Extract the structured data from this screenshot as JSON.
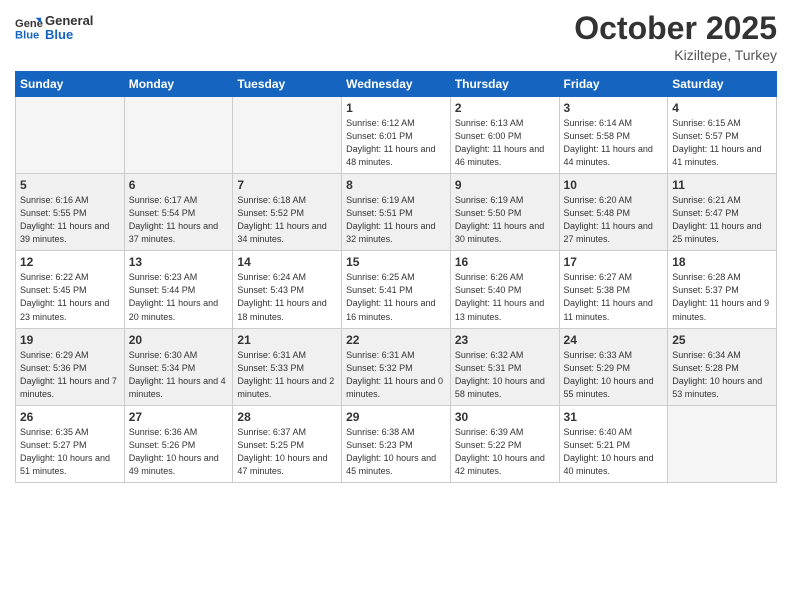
{
  "logo": {
    "line1": "General",
    "line2": "Blue"
  },
  "title": "October 2025",
  "subtitle": "Kiziltepe, Turkey",
  "weekdays": [
    "Sunday",
    "Monday",
    "Tuesday",
    "Wednesday",
    "Thursday",
    "Friday",
    "Saturday"
  ],
  "weeks": [
    [
      {
        "day": "",
        "empty": true
      },
      {
        "day": "",
        "empty": true
      },
      {
        "day": "",
        "empty": true
      },
      {
        "day": "1",
        "sunrise": "6:12 AM",
        "sunset": "6:01 PM",
        "daylight": "11 hours and 48 minutes."
      },
      {
        "day": "2",
        "sunrise": "6:13 AM",
        "sunset": "6:00 PM",
        "daylight": "11 hours and 46 minutes."
      },
      {
        "day": "3",
        "sunrise": "6:14 AM",
        "sunset": "5:58 PM",
        "daylight": "11 hours and 44 minutes."
      },
      {
        "day": "4",
        "sunrise": "6:15 AM",
        "sunset": "5:57 PM",
        "daylight": "11 hours and 41 minutes."
      }
    ],
    [
      {
        "day": "5",
        "sunrise": "6:16 AM",
        "sunset": "5:55 PM",
        "daylight": "11 hours and 39 minutes."
      },
      {
        "day": "6",
        "sunrise": "6:17 AM",
        "sunset": "5:54 PM",
        "daylight": "11 hours and 37 minutes."
      },
      {
        "day": "7",
        "sunrise": "6:18 AM",
        "sunset": "5:52 PM",
        "daylight": "11 hours and 34 minutes."
      },
      {
        "day": "8",
        "sunrise": "6:19 AM",
        "sunset": "5:51 PM",
        "daylight": "11 hours and 32 minutes."
      },
      {
        "day": "9",
        "sunrise": "6:19 AM",
        "sunset": "5:50 PM",
        "daylight": "11 hours and 30 minutes."
      },
      {
        "day": "10",
        "sunrise": "6:20 AM",
        "sunset": "5:48 PM",
        "daylight": "11 hours and 27 minutes."
      },
      {
        "day": "11",
        "sunrise": "6:21 AM",
        "sunset": "5:47 PM",
        "daylight": "11 hours and 25 minutes."
      }
    ],
    [
      {
        "day": "12",
        "sunrise": "6:22 AM",
        "sunset": "5:45 PM",
        "daylight": "11 hours and 23 minutes."
      },
      {
        "day": "13",
        "sunrise": "6:23 AM",
        "sunset": "5:44 PM",
        "daylight": "11 hours and 20 minutes."
      },
      {
        "day": "14",
        "sunrise": "6:24 AM",
        "sunset": "5:43 PM",
        "daylight": "11 hours and 18 minutes."
      },
      {
        "day": "15",
        "sunrise": "6:25 AM",
        "sunset": "5:41 PM",
        "daylight": "11 hours and 16 minutes."
      },
      {
        "day": "16",
        "sunrise": "6:26 AM",
        "sunset": "5:40 PM",
        "daylight": "11 hours and 13 minutes."
      },
      {
        "day": "17",
        "sunrise": "6:27 AM",
        "sunset": "5:38 PM",
        "daylight": "11 hours and 11 minutes."
      },
      {
        "day": "18",
        "sunrise": "6:28 AM",
        "sunset": "5:37 PM",
        "daylight": "11 hours and 9 minutes."
      }
    ],
    [
      {
        "day": "19",
        "sunrise": "6:29 AM",
        "sunset": "5:36 PM",
        "daylight": "11 hours and 7 minutes."
      },
      {
        "day": "20",
        "sunrise": "6:30 AM",
        "sunset": "5:34 PM",
        "daylight": "11 hours and 4 minutes."
      },
      {
        "day": "21",
        "sunrise": "6:31 AM",
        "sunset": "5:33 PM",
        "daylight": "11 hours and 2 minutes."
      },
      {
        "day": "22",
        "sunrise": "6:31 AM",
        "sunset": "5:32 PM",
        "daylight": "11 hours and 0 minutes."
      },
      {
        "day": "23",
        "sunrise": "6:32 AM",
        "sunset": "5:31 PM",
        "daylight": "10 hours and 58 minutes."
      },
      {
        "day": "24",
        "sunrise": "6:33 AM",
        "sunset": "5:29 PM",
        "daylight": "10 hours and 55 minutes."
      },
      {
        "day": "25",
        "sunrise": "6:34 AM",
        "sunset": "5:28 PM",
        "daylight": "10 hours and 53 minutes."
      }
    ],
    [
      {
        "day": "26",
        "sunrise": "6:35 AM",
        "sunset": "5:27 PM",
        "daylight": "10 hours and 51 minutes."
      },
      {
        "day": "27",
        "sunrise": "6:36 AM",
        "sunset": "5:26 PM",
        "daylight": "10 hours and 49 minutes."
      },
      {
        "day": "28",
        "sunrise": "6:37 AM",
        "sunset": "5:25 PM",
        "daylight": "10 hours and 47 minutes."
      },
      {
        "day": "29",
        "sunrise": "6:38 AM",
        "sunset": "5:23 PM",
        "daylight": "10 hours and 45 minutes."
      },
      {
        "day": "30",
        "sunrise": "6:39 AM",
        "sunset": "5:22 PM",
        "daylight": "10 hours and 42 minutes."
      },
      {
        "day": "31",
        "sunrise": "6:40 AM",
        "sunset": "5:21 PM",
        "daylight": "10 hours and 40 minutes."
      },
      {
        "day": "",
        "empty": true
      }
    ]
  ]
}
